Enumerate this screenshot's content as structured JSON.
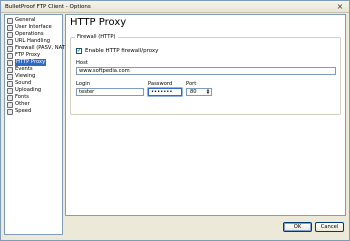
{
  "window": {
    "title": "BulletProof FTP Client - Options",
    "close_glyph": "×"
  },
  "sidebar": {
    "items": [
      {
        "label": "General",
        "icon": "general-icon"
      },
      {
        "label": "User Interface",
        "icon": "user-interface-icon"
      },
      {
        "label": "Operations",
        "icon": "operations-icon"
      },
      {
        "label": "URL Handling",
        "icon": "url-handling-icon"
      },
      {
        "label": "Firewall (PASV, NAT)",
        "icon": "firewall-icon"
      },
      {
        "label": "FTP Proxy",
        "icon": "ftp-proxy-icon"
      },
      {
        "label": "HTTP Proxy",
        "icon": "http-proxy-icon",
        "selected": true
      },
      {
        "label": "Events",
        "icon": "events-icon"
      },
      {
        "label": "Viewing",
        "icon": "viewing-icon"
      },
      {
        "label": "Sound",
        "icon": "sound-icon"
      },
      {
        "label": "Uploading",
        "icon": "uploading-icon"
      },
      {
        "label": "Fonts",
        "icon": "fonts-icon"
      },
      {
        "label": "Other",
        "icon": "other-icon"
      },
      {
        "label": "Speed",
        "icon": "speed-icon"
      }
    ]
  },
  "page": {
    "title": "HTTP Proxy",
    "group_label": "Firewall (HTTP)",
    "enable_checkbox": {
      "label": "Enable HTTP firewall/proxy",
      "checked": true,
      "mark": "✔"
    },
    "host": {
      "label": "Host",
      "value": "www.softpedia.com"
    },
    "login": {
      "label": "Login",
      "value": "tester"
    },
    "password": {
      "label": "Password",
      "value": "•••••••"
    },
    "port": {
      "label": "Port",
      "value": "80",
      "up": "▲",
      "down": "▼"
    }
  },
  "buttons": {
    "ok": "OK",
    "cancel": "Cancel"
  }
}
